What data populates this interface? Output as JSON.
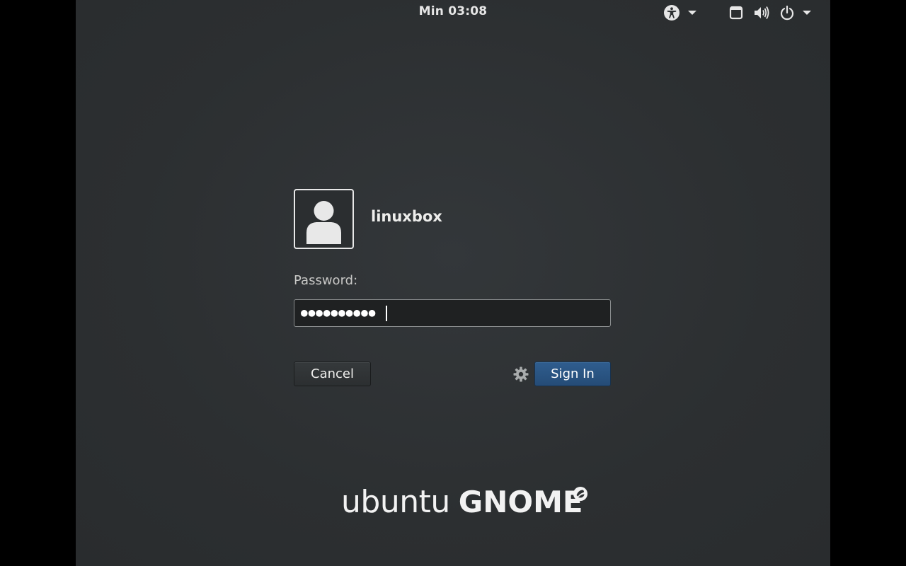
{
  "topbar": {
    "clock": "Min 03:08",
    "icons": [
      "accessibility-icon",
      "chevron-down-icon",
      "window-icon",
      "volume-icon",
      "power-icon",
      "chevron-down-icon"
    ]
  },
  "login": {
    "username": "linuxbox",
    "password_label": "Password:",
    "password_value": "●●●●●●●●●●",
    "cancel_label": "Cancel",
    "signin_label": "Sign In"
  },
  "branding": {
    "ubuntu": "ubuntu",
    "gnome": "GNOME"
  },
  "colors": {
    "background": "#2d3032",
    "accent": "#2a5485",
    "text": "#eeeeec"
  }
}
